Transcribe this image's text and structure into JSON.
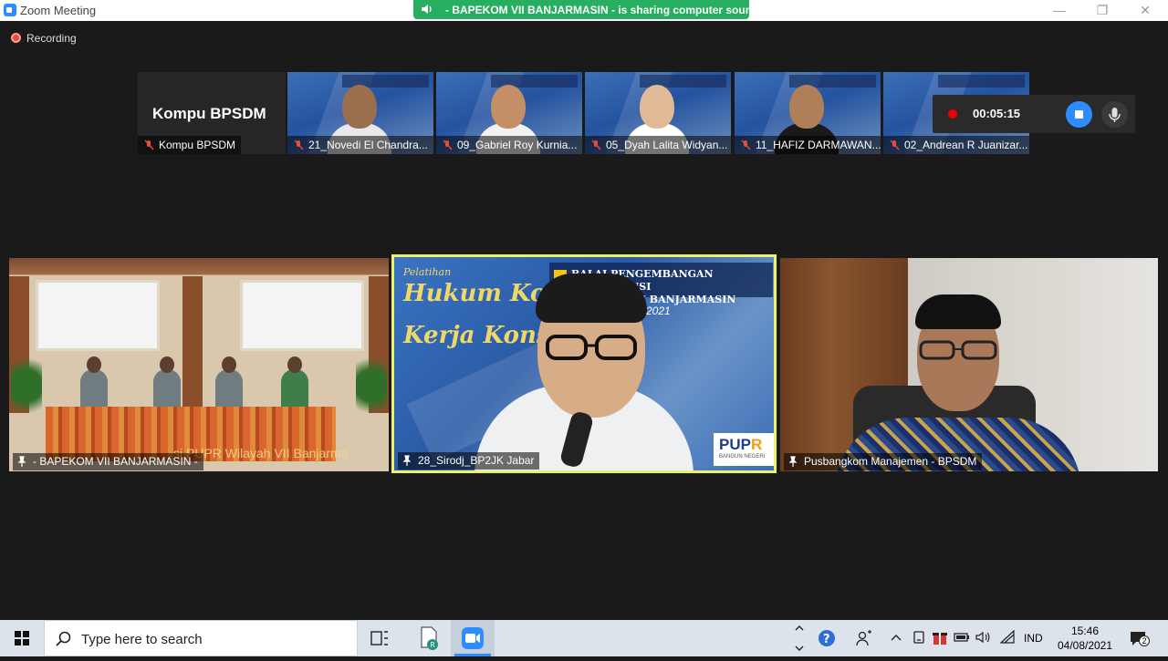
{
  "window": {
    "title": "Zoom Meeting",
    "share_banner": "- BAPEKOM VII BANJARMASIN - is sharing computer sound",
    "recording_label": "Recording"
  },
  "recording_panel": {
    "timer": "00:05:15"
  },
  "thumbnails": [
    {
      "name": "Kompu BPSDM",
      "display_name": "Kompu BPSDM",
      "muted": true,
      "video": false
    },
    {
      "name": "21_Novedi El Chandra...",
      "muted": true,
      "video": true
    },
    {
      "name": "09_Gabriel Roy Kurnia...",
      "muted": true,
      "video": true
    },
    {
      "name": "05_Dyah Lalita Widyan...",
      "muted": true,
      "video": true
    },
    {
      "name": "11_HAFIZ DARMAWAN...",
      "muted": true,
      "video": true
    },
    {
      "name": "02_Andrean R Juanizar...",
      "muted": true,
      "video": true
    }
  ],
  "tiles": [
    {
      "name": "- BAPEKOM VII BANJARMASIN -",
      "banner_text": "si PUPR Wilayah VII Banjarma"
    },
    {
      "name": "28_Sirodj_BP2JK Jabar",
      "active_speaker": true,
      "slide": {
        "line1": "Pelatihan",
        "line2": "Hukum Kontrak",
        "line3": "Kerja Konstruksi",
        "header_line1": "BALAI PENGEMBANGAN KOMPETENSI",
        "header_line2": "WILAYAH VII BANJARMASIN",
        "year": "2021",
        "logo_text_a": "PUP",
        "logo_text_b": "R",
        "logo_sub": "BANGUN NEGERI"
      }
    },
    {
      "name": "Pusbangkom Manajemen - BPSDM"
    }
  ],
  "taskbar": {
    "search_placeholder": "Type here to search",
    "language": "IND",
    "time": "15:46",
    "date": "04/08/2021",
    "notification_count": "2"
  },
  "colors": {
    "accent": "#2d8cff",
    "share_banner": "#27ae60",
    "active_speaker_border": "#e8f26a",
    "recording": "#e74c3c"
  }
}
